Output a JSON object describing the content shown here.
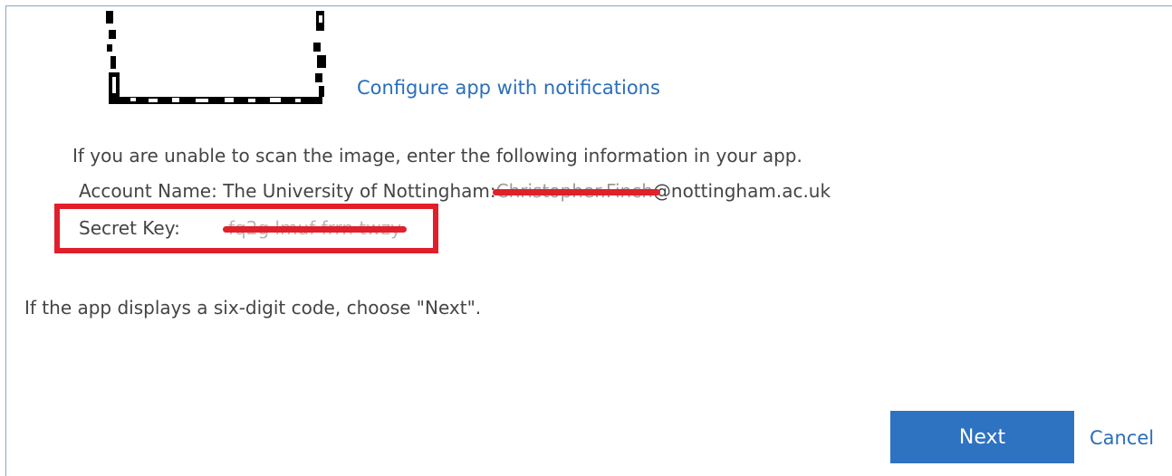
{
  "qr": {
    "icon": "qr-code-icon"
  },
  "configure_link": "Configure app with notifications",
  "info_text": "If you are unable to scan the image, enter the following information in your app.",
  "account": {
    "label": "Account Name: The University of Nottingham:",
    "hidden_part": "Christopher.Finch",
    "suffix": "@nottingham.ac.uk"
  },
  "secret": {
    "label": "Secret Key:",
    "value": "fq2g lmuf frrn twzy"
  },
  "hint_text": "If the app displays a six-digit code, choose \"Next\".",
  "buttons": {
    "next_label": "Next",
    "cancel_label": "Cancel"
  },
  "colors": {
    "accent": "#2e72c2",
    "link": "#2a6ebb",
    "redaction": "#e0202a"
  }
}
